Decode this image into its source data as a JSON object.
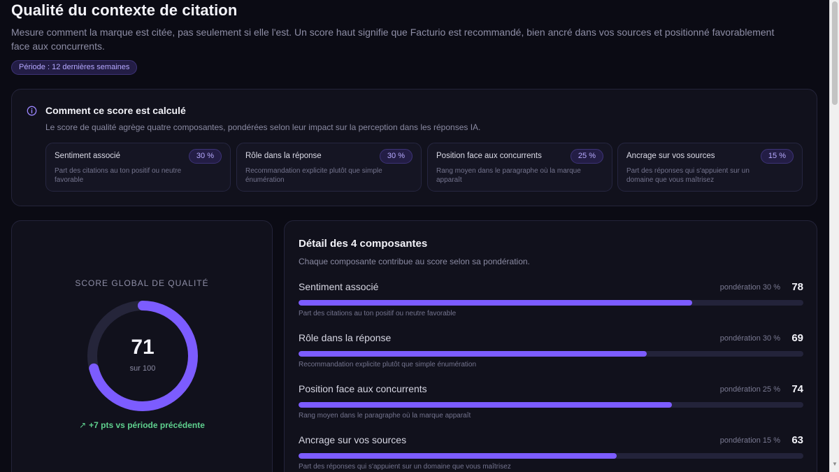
{
  "header": {
    "title": "Qualité du contexte de citation",
    "subtitle": "Mesure comment la marque est citée, pas seulement si elle l'est. Un score haut signifie que Facturio est recommandé, bien ancré dans vos sources et positionné favorablement face aux concurrents.",
    "period": "Période : 12 dernières semaines"
  },
  "info": {
    "icon": "info-icon",
    "title": "Comment ce score est calculé",
    "description": "Le score de qualité agrège quatre composantes, pondérées selon leur impact sur la perception dans les réponses IA.",
    "components": [
      {
        "name": "Sentiment associé",
        "weight": "30 %",
        "desc": "Part des citations au ton positif ou neutre favorable"
      },
      {
        "name": "Rôle dans la réponse",
        "weight": "30 %",
        "desc": "Recommandation explicite plutôt que simple énumération"
      },
      {
        "name": "Position face aux concurrents",
        "weight": "25 %",
        "desc": "Rang moyen dans le paragraphe où la marque apparaît"
      },
      {
        "name": "Ancrage sur vos sources",
        "weight": "15 %",
        "desc": "Part des réponses qui s'appuient sur un domaine que vous maîtrisez"
      }
    ]
  },
  "score": {
    "label": "SCORE GLOBAL DE QUALITÉ",
    "value": "71",
    "max_label": "sur 100",
    "fraction": 0.71,
    "trend_icon": "trend-up-arrow-icon",
    "trend": "+7 pts vs période précédente"
  },
  "detail": {
    "title": "Détail des 4 composantes",
    "subtitle": "Chaque composante contribue au score selon sa pondération.",
    "rows": [
      {
        "name": "Sentiment associé",
        "weight": "pondération 30 %",
        "value": "78",
        "fraction": 0.78,
        "desc": "Part des citations au ton positif ou neutre favorable"
      },
      {
        "name": "Rôle dans la réponse",
        "weight": "pondération 30 %",
        "value": "69",
        "fraction": 0.69,
        "desc": "Recommandation explicite plutôt que simple énumération"
      },
      {
        "name": "Position face aux concurrents",
        "weight": "pondération 25 %",
        "value": "74",
        "fraction": 0.74,
        "desc": "Rang moyen dans le paragraphe où la marque apparaît"
      },
      {
        "name": "Ancrage sur vos sources",
        "weight": "pondération 15 %",
        "value": "63",
        "fraction": 0.63,
        "desc": "Part des réponses qui s'appuient sur un domaine que vous maîtrisez"
      }
    ]
  },
  "colors": {
    "accent": "#7c5cff",
    "positive": "#5fd08e",
    "background": "#0b0b14",
    "card": "#11111c"
  }
}
